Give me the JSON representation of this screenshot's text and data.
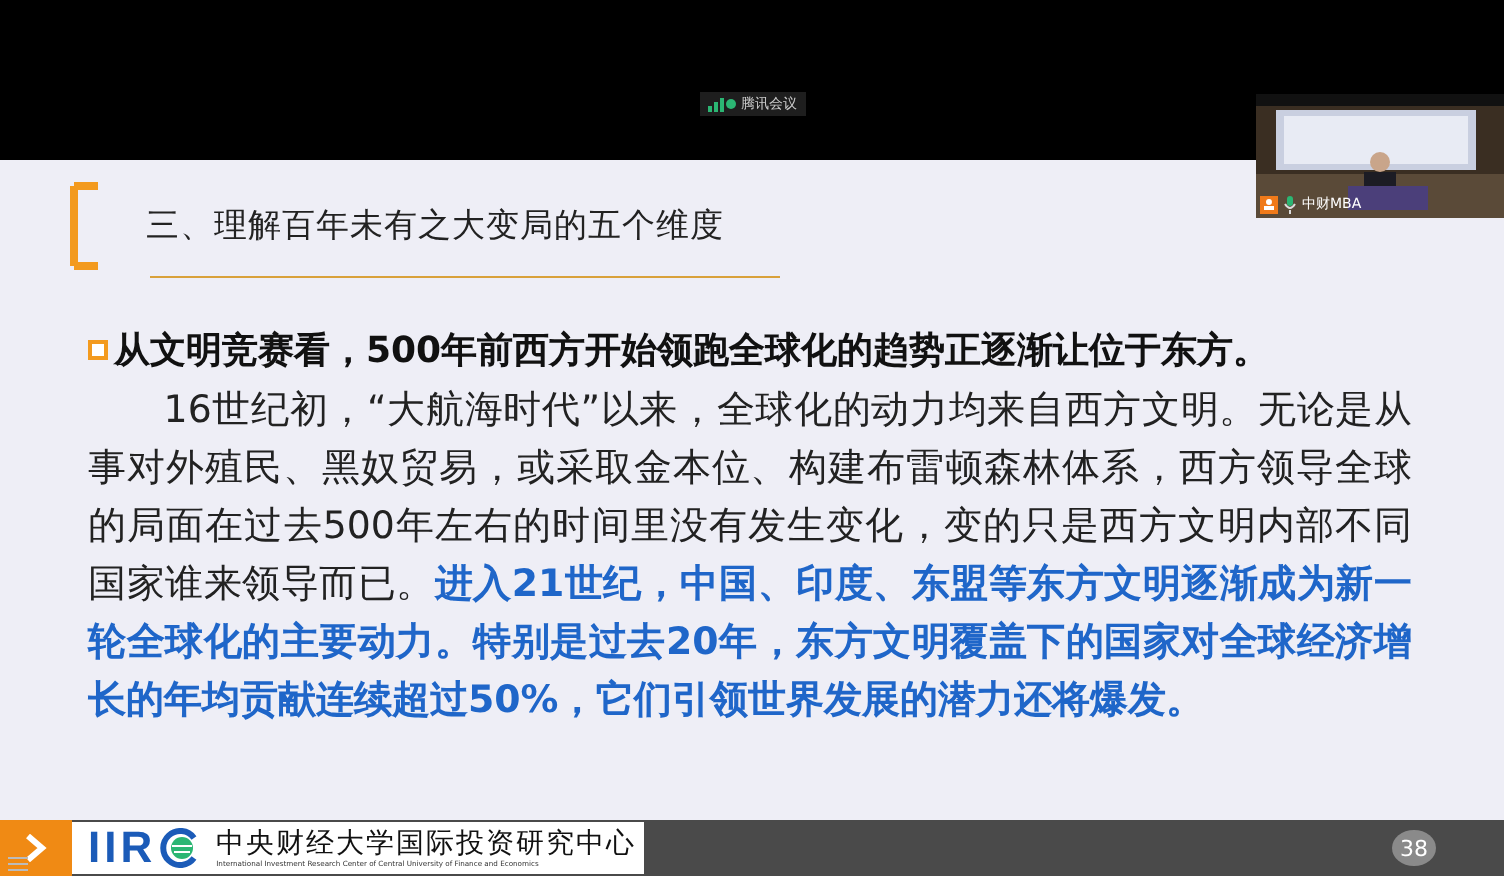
{
  "meeting": {
    "app_name": "腾讯会议"
  },
  "video_tile": {
    "name": "中财MBA"
  },
  "slide": {
    "title": "三、理解百年未有之大变局的五个维度",
    "heading": "从文明竞赛看，500年前西方开始领跑全球化的趋势正逐渐让位于东方。",
    "body": "16世纪初，“大航海时代”以来，全球化的动力均来自西方文明。无论是从事对外殖民、黑奴贸易，或采取金本位、构建布雷顿森林体系，西方领导全球的局面在过去500年左右的时间里没有发生变化，变的只是西方文明内部不同国家谁来领导而已。",
    "highlight": "进入21世纪，中国、印度、东盟等东方文明逐渐成为新一轮全球化的主要动力。特别是过去20年，东方文明覆盖下的国家对全球经济增长的年均贡献连续超过50%，它们引领世界发展的潜力还将爆发。",
    "footer": {
      "logo": "IIR",
      "org_name": "中央财经大学国际投资研究中心",
      "org_name_en": "International Investment Research Center of Central University of Finance and Economics",
      "page_number": "38"
    }
  }
}
